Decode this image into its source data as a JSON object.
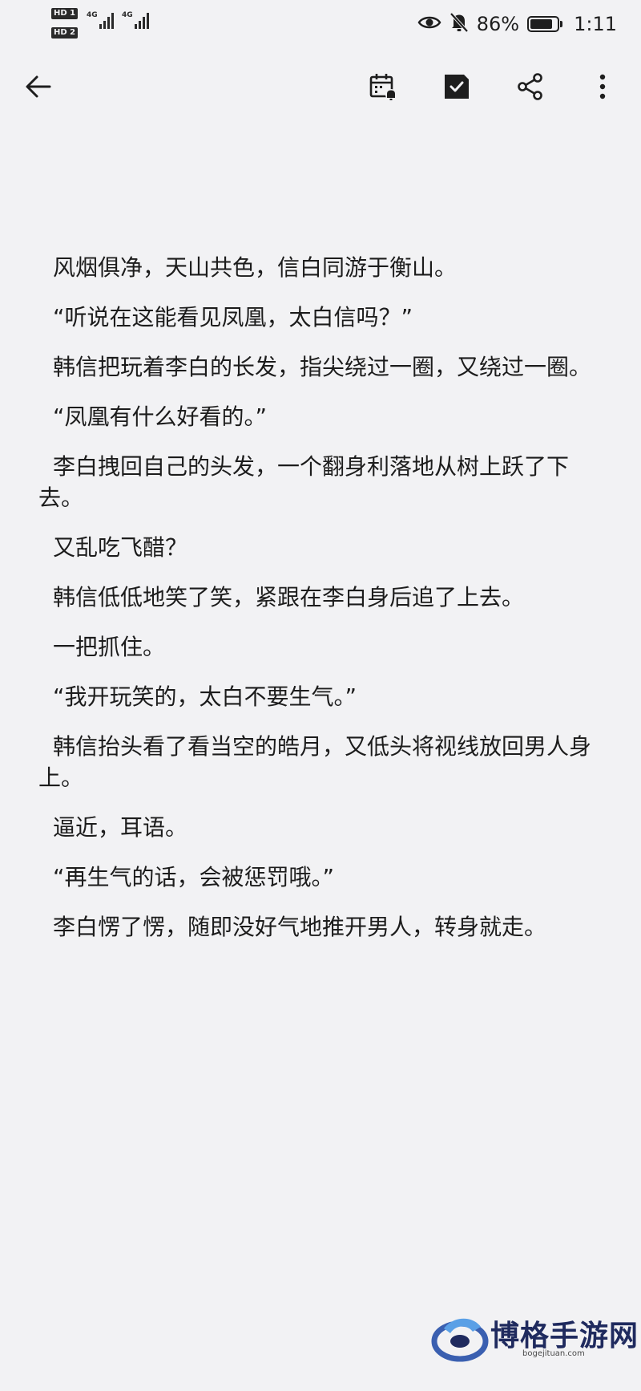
{
  "status_bar": {
    "sim1_label": "HD 1",
    "sim2_label": "HD 2",
    "net1_type": "4G",
    "net2_type": "4G",
    "battery_percent": "86%",
    "battery_level": 0.86,
    "time": "1:11",
    "icons": [
      "eye-icon",
      "bell-muted-icon",
      "battery-icon"
    ]
  },
  "toolbar": {
    "icons": [
      "back-arrow-icon",
      "calendar-alarm-icon",
      "save-check-icon",
      "share-icon",
      "more-vertical-icon"
    ]
  },
  "article": {
    "paragraphs": [
      "风烟俱净，天山共色，信白同游于衡山。",
      "“听说在这能看见凤凰，太白信吗？”",
      "韩信把玩着李白的长发，指尖绕过一圈，又绕过一圈。",
      "“凤凰有什么好看的。”",
      "李白拽回自己的头发，一个翻身利落地从树上跃了下去。",
      "又乱吃飞醋？",
      "韩信低低地笑了笑，紧跟在李白身后追了上去。",
      "一把抓住。",
      "“我开玩笑的，太白不要生气。”",
      "韩信抬头看了看当空的皓月，又低头将视线放回男人身上。",
      "逼近，耳语。",
      "“再生气的话，会被惩罚哦。”",
      "李白愣了愣，随即没好气地推开男人，转身就走。"
    ]
  },
  "watermark": {
    "brand": "博格手游网",
    "url": "bogejituan.com"
  },
  "colors": {
    "background": "#f2f2f4",
    "text": "#1c1c1c",
    "watermark_brand": "#1f2a5e",
    "watermark_logo": "#3a5fb0"
  }
}
